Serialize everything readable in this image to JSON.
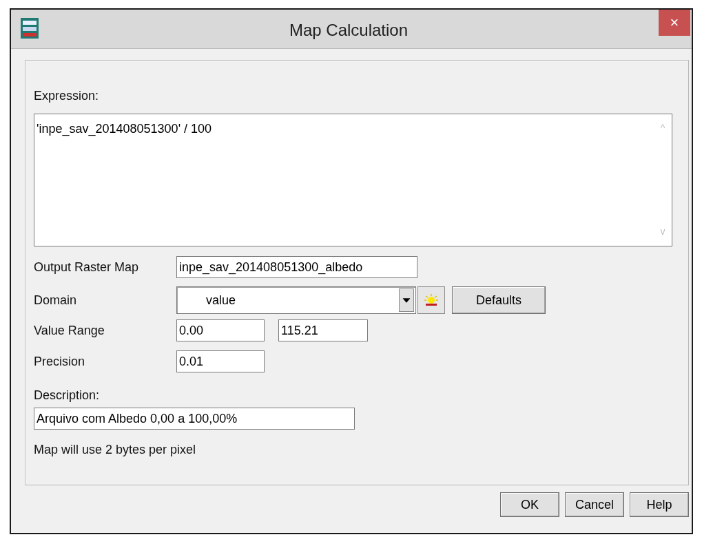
{
  "window": {
    "title": "Map Calculation",
    "close": "×"
  },
  "expression": {
    "label": "Expression:",
    "value": "'inpe_sav_201408051300' / 100",
    "scroll_up": "^",
    "scroll_down": "v"
  },
  "output_raster_map": {
    "label": "Output Raster Map",
    "value": "inpe_sav_201408051300_albedo"
  },
  "domain": {
    "label": "Domain",
    "value": "value",
    "button": "Defaults"
  },
  "value_range": {
    "label": "Value Range",
    "min": "0.00",
    "max": "115.21"
  },
  "precision": {
    "label": "Precision",
    "value": "0.01"
  },
  "description": {
    "label": "Description:",
    "value": "Arquivo com Albedo 0,00 a 100,00%"
  },
  "info": "Map will use 2 bytes per pixel",
  "buttons": [
    "OK",
    "Cancel",
    "Help"
  ]
}
